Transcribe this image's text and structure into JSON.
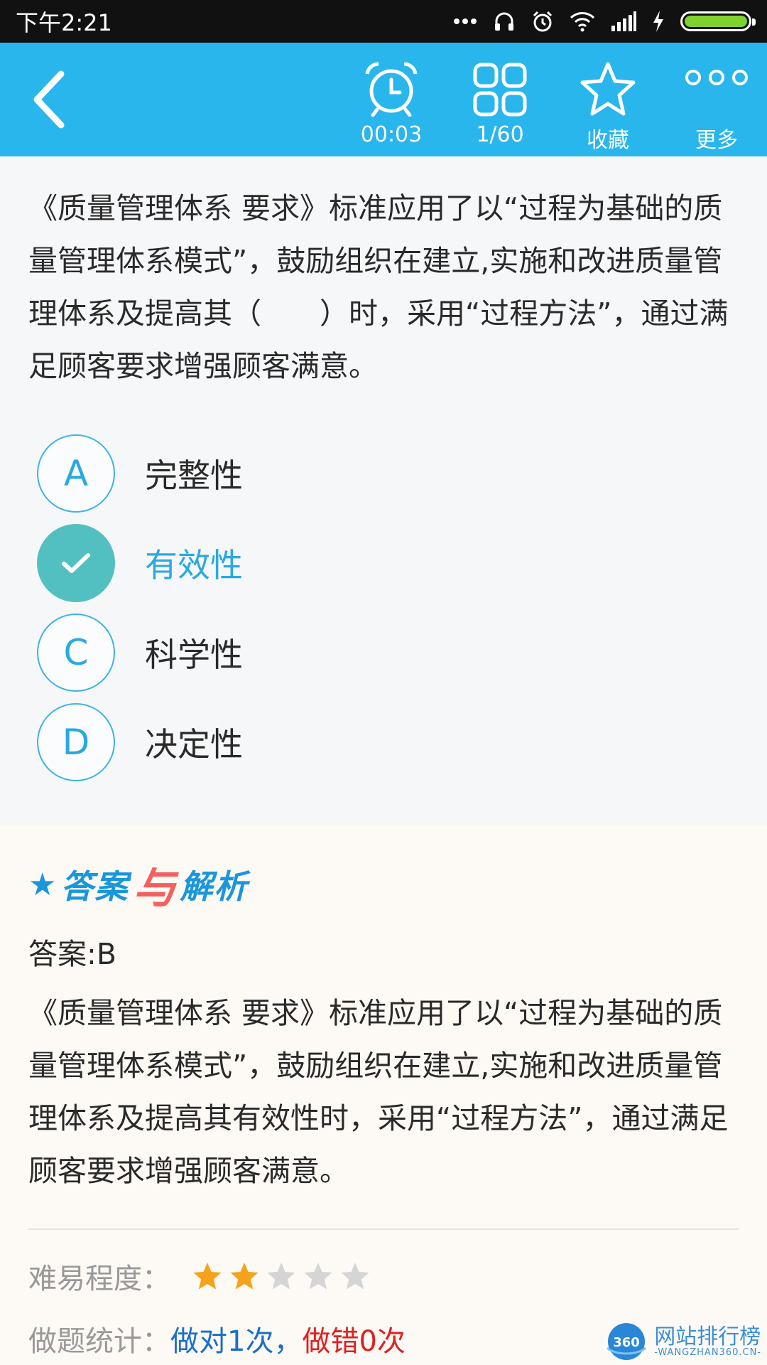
{
  "status_bar": {
    "time": "下午2:21"
  },
  "toolbar": {
    "timer": "00:03",
    "progress": "1/60",
    "favorite_label": "收藏",
    "more_label": "更多"
  },
  "question": {
    "text": "《质量管理体系 要求》标准应用了以“过程为基础的质量管理体系模式”，鼓励组织在建立,实施和改进质量管理体系及提高其（　　）时，采用“过程方法”，通过满足顾客要求增强顾客满意。"
  },
  "options": [
    {
      "letter": "A",
      "text": "完整性"
    },
    {
      "letter": "B",
      "text": "有效性"
    },
    {
      "letter": "C",
      "text": "科学性"
    },
    {
      "letter": "D",
      "text": "决定性"
    }
  ],
  "selected_option": "B",
  "analysis": {
    "title_part1": "答案",
    "title_connector": "与",
    "title_part2": "解析",
    "answer": "答案:B",
    "text": "《质量管理体系 要求》标准应用了以“过程为基础的质量管理体系模式”，鼓励组织在建立,实施和改进质量管理体系及提高其有效性时，采用“过程方法”，通过满足顾客要求增强顾客满意。",
    "difficulty_label": "难易程度：",
    "difficulty_rating": 2,
    "difficulty_max": 5,
    "stats_label": "做题统计：",
    "right_count": "做对1次",
    "separator": "，",
    "wrong_count": "做错0次"
  },
  "watermark": {
    "logo_text": "360",
    "main": "网站排行榜",
    "sub": "-WANGZHAN360.CN-"
  },
  "colors": {
    "appbar": "#29b6ec",
    "accent": "#2aa8e2",
    "check": "#52c0c0",
    "star_filled": "#f7a21b",
    "star_empty": "#d5d5d5",
    "right": "#1a6fc9",
    "wrong": "#e02020"
  }
}
